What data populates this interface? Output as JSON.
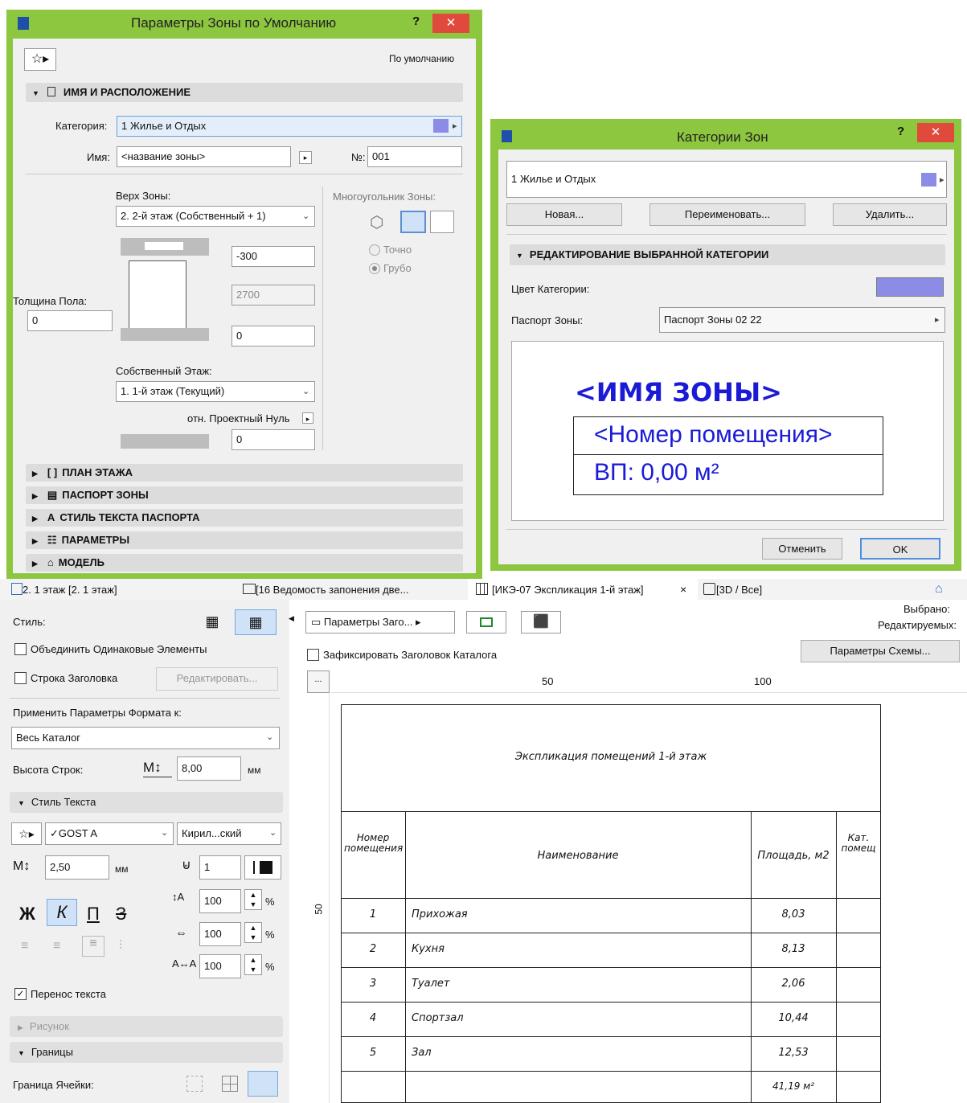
{
  "zone_dialog": {
    "title": "Параметры Зоны по Умолчанию",
    "help": "?",
    "close": "✕",
    "default_label": "По умолчанию",
    "section_name": "ИМЯ И РАСПОЛОЖЕНИЕ",
    "category_label": "Категория:",
    "category_value": "1  Жилье и Отдых",
    "name_label": "Имя:",
    "name_value": "<название зоны>",
    "number_label": "№:",
    "number_value": "001",
    "top_label": "Верх Зоны:",
    "top_value": "2. 2-й этаж (Собственный + 1)",
    "polygon_label": "Многоугольник Зоны:",
    "top_offset": "-300",
    "height": "2700",
    "bottom_offset": "0",
    "exact_label": "Точно",
    "rough_label": "Грубо",
    "floor_thickness_label": "Толщина Пола:",
    "floor_thickness_value": "0",
    "home_story_label": "Собственный Этаж:",
    "home_story_value": "1. 1-й этаж (Текущий)",
    "zero_label": "отн. Проектный Нуль",
    "zero_value": "0",
    "sections": [
      "ПЛАН ЭТАЖА",
      "ПАСПОРТ ЗОНЫ",
      "СТИЛЬ ТЕКСТА ПАСПОРТА",
      "ПАРАМЕТРЫ",
      "МОДЕЛЬ"
    ]
  },
  "categories_dialog": {
    "title": "Категории Зон",
    "help": "?",
    "close": "✕",
    "selected": "1  Жилье и Отдых",
    "new_btn": "Новая...",
    "rename_btn": "Переименовать...",
    "delete_btn": "Удалить...",
    "edit_section": "РЕДАКТИРОВАНИЕ ВЫБРАННОЙ КАТЕГОРИИ",
    "color_label": "Цвет Категории:",
    "stamp_label": "Паспорт Зоны:",
    "stamp_value": "Паспорт Зоны 02 22",
    "preview_name": "<ИМЯ ЗОНЫ>",
    "preview_number": "<Номер помещения>",
    "preview_area": "ВП: 0,00 м²",
    "cancel_btn": "Отменить",
    "ok_btn": "OK"
  },
  "tabs": [
    {
      "label": "2. 1 этаж [2. 1 этаж]"
    },
    {
      "label": "[16 Ведомость запонения две..."
    },
    {
      "label": "[ИКЭ-07 Экспликация 1-й этаж]"
    },
    {
      "label": "[3D / Все]"
    }
  ],
  "tab_close": "×",
  "left_panel": {
    "style_label": "Стиль:",
    "merge_label": "Объединить Одинаковые Элементы",
    "header_row_label": "Строка Заголовка",
    "edit_btn": "Редактировать...",
    "apply_label": "Применить Параметры Формата к:",
    "apply_value": "Весь Каталог",
    "row_height_label": "Высота Строк:",
    "row_height_value": "8,00",
    "unit_mm": "мм",
    "text_style_section": "Стиль Текста",
    "font_value": "✓GOST A",
    "charset_value": "Кирил...ский",
    "font_size_value": "2,50",
    "pen_value": "1",
    "bold": "Ж",
    "italic": "К",
    "underline": "П",
    "strike": "З",
    "pct_1": "100",
    "pct_2": "100",
    "pct_3": "100",
    "pct_sign": "%",
    "wrap_label": "Перенос текста",
    "picture_section": "Рисунок",
    "borders_section": "Границы",
    "cell_border_label": "Граница Ячейки:"
  },
  "schedule": {
    "header_params": "Параметры Заго...",
    "selected_label": "Выбрано:",
    "editable_label": "Редактируемых:",
    "scheme_btn": "Параметры Схемы...",
    "freeze_label": "Зафиксировать Заголовок Каталога",
    "ruler_dots": "...",
    "ruler_50": "50",
    "ruler_100": "100",
    "vruler_50": "50",
    "title": "Экспликация помещений 1-й этаж",
    "col_num": "Номер помещения",
    "col_name": "Наименование",
    "col_area": "Площадь, м2",
    "col_cat": "Кат. помещ",
    "rows": [
      {
        "num": "1",
        "name": "Прихожая",
        "area": "8,03"
      },
      {
        "num": "2",
        "name": "Кухня",
        "area": "8,13"
      },
      {
        "num": "3",
        "name": "Туалет",
        "area": "2,06"
      },
      {
        "num": "4",
        "name": "Спортзал",
        "area": "10,44"
      },
      {
        "num": "5",
        "name": "Зал",
        "area": "12,53"
      }
    ],
    "total": "41,19 м²"
  },
  "colors": {
    "frame": "#8dc63f",
    "category": "#8c8ce6",
    "preview_text": "#1b1bd6"
  }
}
